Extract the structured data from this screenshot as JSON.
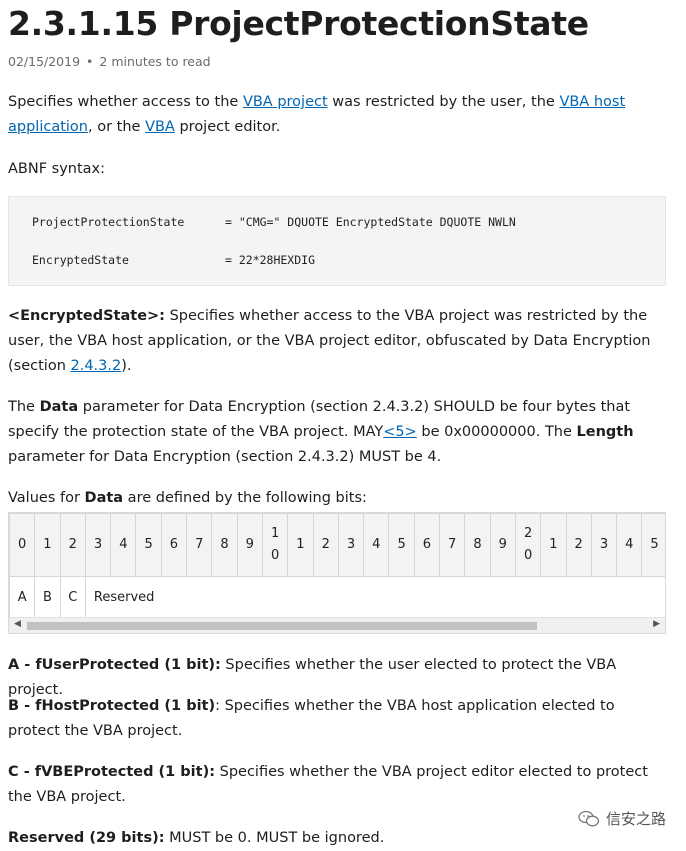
{
  "title": "2.3.1.15 ProjectProtectionState",
  "meta": {
    "date": "02/15/2019",
    "read_time": "2 minutes to read"
  },
  "intro": {
    "t1": "Specifies whether access to the ",
    "link1": "VBA project",
    "t2": " was restricted by the user, the ",
    "link2": "VBA host application",
    "t3": ", or the ",
    "link3": "VBA",
    "t4": " project editor."
  },
  "abnf_label": "ABNF syntax:",
  "code": {
    "line1_left": "ProjectProtectionState",
    "line1_right": "= \"CMG=\" DQUOTE EncryptedState DQUOTE NWLN",
    "line2_left": "EncryptedState",
    "line2_right": "= 22*28HEXDIG"
  },
  "encrypted": {
    "term": "<EncryptedState>:",
    "text": " Specifies whether access to the VBA project was restricted by the user, the VBA host application, or the VBA project editor, obfuscated by Data Encryption (section ",
    "link": "2.4.3.2",
    "end": ")."
  },
  "data_param": {
    "t1": "The ",
    "b1": "Data",
    "t2": " parameter for Data Encryption (section 2.4.3.2) SHOULD be four bytes that specify the protection state of the VBA project. MAY",
    "link": "<5>",
    "t3": " be 0x00000000. The ",
    "b2": "Length",
    "t4": " parameter for Data Encryption (section 2.4.3.2) MUST be 4."
  },
  "values_label": {
    "t1": "Values for ",
    "b1": "Data",
    "t2": " are defined by the following bits:"
  },
  "bit_table": {
    "headers": [
      [
        "0"
      ],
      [
        "1"
      ],
      [
        "2"
      ],
      [
        "3"
      ],
      [
        "4"
      ],
      [
        "5"
      ],
      [
        "6"
      ],
      [
        "7"
      ],
      [
        "8"
      ],
      [
        "9"
      ],
      [
        "1",
        "0"
      ],
      [
        "1"
      ],
      [
        "2"
      ],
      [
        "3"
      ],
      [
        "4"
      ],
      [
        "5"
      ],
      [
        "6"
      ],
      [
        "7"
      ],
      [
        "8"
      ],
      [
        "9"
      ],
      [
        "2",
        "0"
      ],
      [
        "1"
      ],
      [
        "2"
      ],
      [
        "3"
      ],
      [
        "4"
      ],
      [
        "5"
      ]
    ],
    "row": [
      "A",
      "B",
      "C",
      "Reserved"
    ]
  },
  "definitions": [
    {
      "term": "A - fUserProtected (1 bit):",
      "text": " Specifies whether the user elected to protect the VBA project."
    },
    {
      "term": "B - fHostProtected (1 bit)",
      "text": ": Specifies whether the VBA host application elected to protect the VBA project."
    },
    {
      "term": "C - fVBEProtected (1 bit):",
      "text": " Specifies whether the VBA project editor elected to protect the VBA project."
    },
    {
      "term": "Reserved (29 bits):",
      "text": " MUST be 0. MUST be ignored."
    }
  ],
  "watermark": "信安之路"
}
